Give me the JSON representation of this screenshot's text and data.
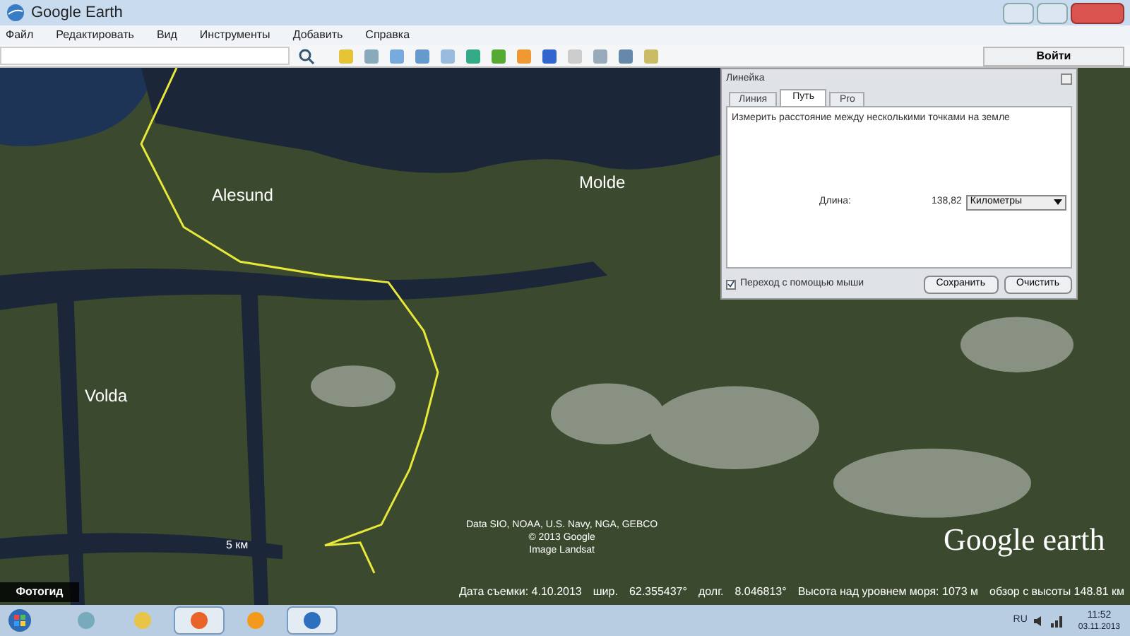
{
  "window": {
    "title": "Google Earth",
    "sign_in": "Войти"
  },
  "menu": [
    "Файл",
    "Редактировать",
    "Вид",
    "Инструменты",
    "Добавить",
    "Справка"
  ],
  "map": {
    "places": [
      {
        "name": "Alesund"
      },
      {
        "name": "Molde"
      },
      {
        "name": "Volda"
      }
    ],
    "scale": "5 км",
    "attribution": [
      "Data SIO, NOAA, U.S. Navy, NGA, GEBCO",
      "© 2013 Google",
      "Image Landsat"
    ],
    "logo": "Google earth",
    "tour_guide": "Фотогид"
  },
  "status_bar": {
    "date": "Дата съемки: 4.10.2013",
    "lat_label": "шир.",
    "lat": "62.355437°",
    "lon_label": "долг.",
    "lon": "8.046813°",
    "elevation": "Высота над уровнем моря: 1073 м",
    "eye_alt": "обзор с высоты 148.81 км"
  },
  "ruler": {
    "title": "Линейка",
    "tabs": [
      {
        "label": "Линия",
        "selected": false
      },
      {
        "label": "Путь",
        "selected": true
      },
      {
        "label": "Pro",
        "selected": false
      }
    ],
    "description": "Измерить расстояние между несколькими точками на земле",
    "length_label": "Длина:",
    "length_value": "138,82",
    "unit": "Километры",
    "mouse_nav": {
      "label": "Переход с помощью мыши",
      "checked": true
    },
    "buttons": [
      "Сохранить",
      "Очистить"
    ]
  },
  "taskbar": {
    "language": "RU",
    "time": "11:52",
    "date": "03.11.2013",
    "apps": [
      {
        "selected": false
      },
      {
        "selected": false
      },
      {
        "selected": true
      },
      {
        "selected": false
      },
      {
        "selected": true
      }
    ]
  }
}
